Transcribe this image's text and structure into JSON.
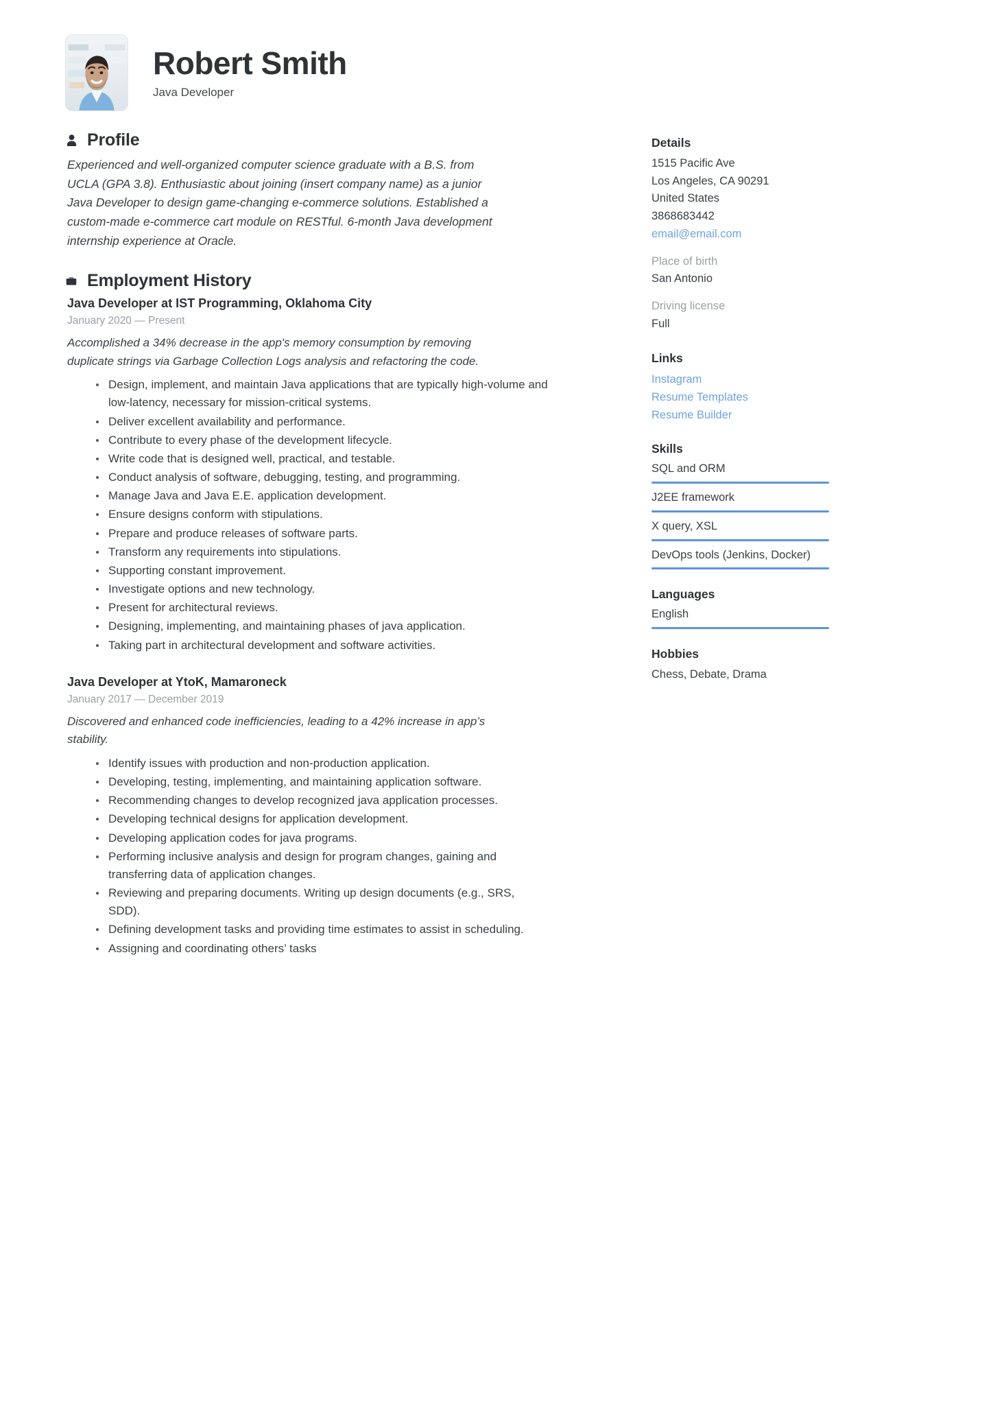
{
  "header": {
    "name": "Robert Smith",
    "job_title": "Java Developer",
    "avatar_alt": "profile-photo"
  },
  "profile": {
    "title": "Profile",
    "icon": "person-icon",
    "text": "Experienced and well-organized computer science graduate with a B.S. from UCLA (GPA 3.8). Enthusiastic about joining (insert company name) as a junior Java Developer to design game-changing e-commerce solutions. Established a custom-made e-commerce cart module on RESTful. 6-month Java development internship experience at Oracle."
  },
  "employment": {
    "title": "Employment History",
    "icon": "briefcase-icon",
    "jobs": [
      {
        "heading": "Java Developer at IST Programming, Oklahoma City",
        "dates": "January 2020 — Present",
        "summary": "Accomplished a 34% decrease in the app's memory consumption by removing duplicate strings via Garbage Collection Logs analysis and refactoring the code.",
        "bullets": [
          "Design, implement, and maintain Java applications that are typically high-volume and low-latency, necessary for mission-critical systems.",
          "Deliver excellent availability and performance.",
          "Contribute to every phase of the development lifecycle.",
          "Write code that is designed well, practical, and testable.",
          "Conduct analysis of software, debugging, testing, and programming.",
          "Manage Java and Java E.E. application development.",
          "Ensure designs conform with stipulations.",
          "Prepare and produce releases of software parts.",
          "Transform any requirements into stipulations.",
          "Supporting constant improvement.",
          "Investigate options and new technology.",
          "Present for architectural reviews.",
          "Designing, implementing, and maintaining phases of java application.",
          "Taking part in architectural development and software activities."
        ]
      },
      {
        "heading": "Java Developer at YtoK, Mamaroneck",
        "dates": "January 2017 — December 2019",
        "summary": "Discovered and enhanced code inefficiencies, leading to a 42% increase in app’s stability.",
        "bullets": [
          "Identify issues with production and non-production application.",
          "Developing, testing, implementing, and maintaining application software.",
          "Recommending changes to develop recognized java application processes.",
          "Developing technical designs for application development.",
          "Developing application codes for java programs.",
          "Performing inclusive analysis and design for program changes, gaining and transferring data of application changes.",
          "Reviewing and preparing documents. Writing up design documents (e.g., SRS, SDD).",
          "Defining development tasks and providing time estimates to assist in scheduling.",
          "Assigning and coordinating others’ tasks"
        ]
      }
    ]
  },
  "sidebar": {
    "details": {
      "title": "Details",
      "address_line1": "1515 Pacific Ave",
      "address_line2": "Los Angeles, CA 90291",
      "country": "United States",
      "phone": "3868683442",
      "email": "email@email.com",
      "place_of_birth_label": "Place of birth",
      "place_of_birth": "San Antonio",
      "driving_license_label": "Driving license",
      "driving_license": "Full"
    },
    "links": {
      "title": "Links",
      "items": [
        {
          "label": "Instagram"
        },
        {
          "label": "Resume Templates"
        },
        {
          "label": "Resume Builder"
        }
      ]
    },
    "skills": {
      "title": "Skills",
      "items": [
        {
          "label": "SQL and ORM",
          "level": 100
        },
        {
          "label": "J2EE framework",
          "level": 100
        },
        {
          "label": "X query, XSL",
          "level": 100
        },
        {
          "label": "DevOps tools (Jenkins, Docker)",
          "level": 100
        }
      ]
    },
    "languages": {
      "title": "Languages",
      "items": [
        {
          "label": "English",
          "level": 100
        }
      ]
    },
    "hobbies": {
      "title": "Hobbies",
      "text": "Chess, Debate, Drama"
    }
  },
  "colors": {
    "accent": "#5f93da",
    "link": "#6fa3e0",
    "text": "#3a3f44",
    "muted": "#9aa0a6"
  }
}
